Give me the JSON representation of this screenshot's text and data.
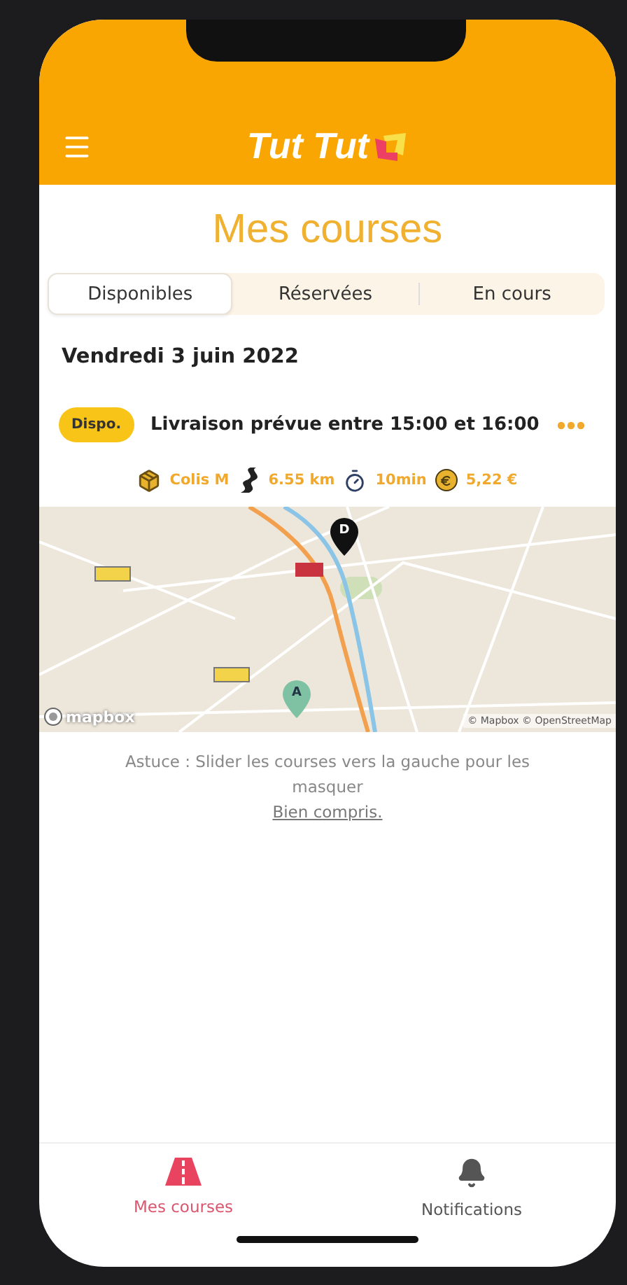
{
  "header": {
    "title": "Tut Tut"
  },
  "page_title": "Mes courses",
  "tabs": [
    {
      "label": "Disponibles",
      "selected": true
    },
    {
      "label": "Réservées",
      "selected": false
    },
    {
      "label": "En cours",
      "selected": false
    }
  ],
  "date": "Vendredi 3 juin 2022",
  "course": {
    "status": "Dispo.",
    "title": "Livraison prévue entre 15:00 et 16:00",
    "stats": [
      {
        "kind": "parcel",
        "text": "Colis M"
      },
      {
        "kind": "road",
        "text": "6.55 km"
      },
      {
        "kind": "timer",
        "text": "10min"
      },
      {
        "kind": "price",
        "text": "5,22 €"
      }
    ],
    "map": {
      "pins": [
        {
          "kind": "destination",
          "label": "D"
        },
        {
          "kind": "origin",
          "label": "A"
        }
      ],
      "logo": "mapbox",
      "attribution": "© Mapbox © OpenStreetMap"
    }
  },
  "tip": {
    "text": "Astuce : Slider les courses vers la gauche pour les masquer",
    "link": "Bien compris."
  },
  "nav": [
    {
      "kind": "courses",
      "label": "Mes courses",
      "selected": true
    },
    {
      "kind": "bell",
      "label": "Notifications",
      "selected": false
    }
  ]
}
